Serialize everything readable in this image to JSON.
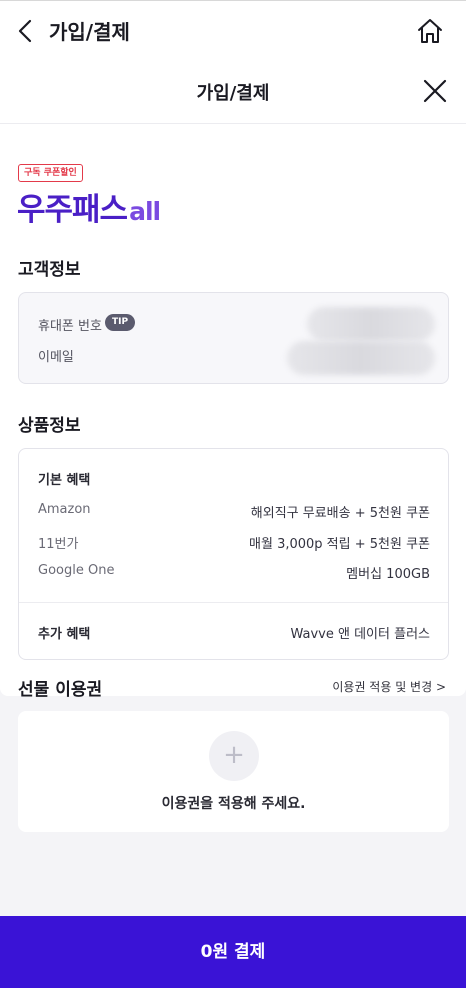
{
  "topbar": {
    "title": "가입/결제"
  },
  "sheet": {
    "title": "가입/결제"
  },
  "promo": {
    "badge": "구독 쿠폰할인",
    "brand_main": "우주패스",
    "brand_suffix": "all",
    "brand_color": "#4a1fc6"
  },
  "customer": {
    "title": "고객정보",
    "phone_label": "휴대폰 번호",
    "tip": "TIP",
    "email_label": "이메일"
  },
  "product": {
    "title": "상품정보",
    "basic_head": "기본 혜택",
    "rows": [
      {
        "label": "Amazon",
        "value": "해외직구 무료배송 + 5천원 쿠폰"
      },
      {
        "label": "11번가",
        "value": "매월 3,000p 적립 + 5천원 쿠폰"
      },
      {
        "label": "Google One",
        "value": "멤버십 100GB"
      }
    ],
    "extra_head": "추가 혜택",
    "extra_value": "Wavve 앤 데이터 플러스"
  },
  "gift": {
    "title": "선물 이용권",
    "link": "이용권 적용 및 변경 >",
    "plus": "+",
    "message": "이용권을 적용해 주세요."
  },
  "pay": {
    "label": "0원 결제",
    "color": "#3a13d6"
  }
}
